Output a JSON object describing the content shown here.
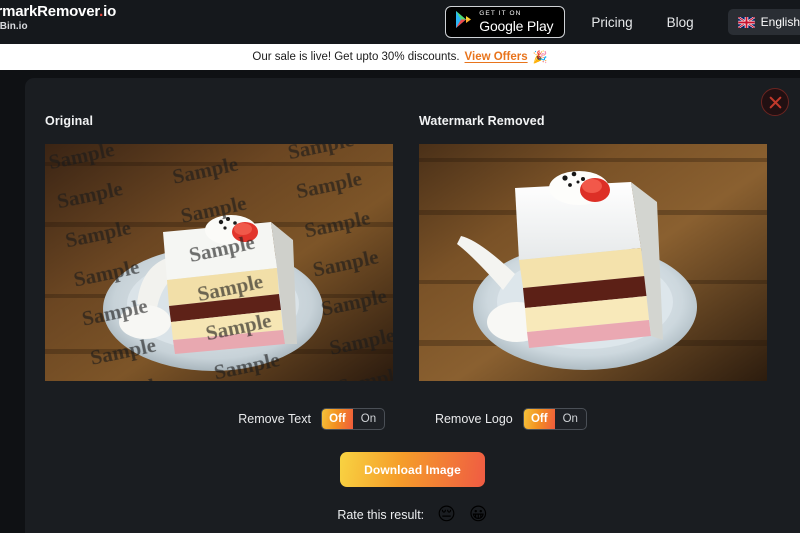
{
  "nav": {
    "brand_main": "WatermarkRemover.io",
    "brand_sub": "by PixelBin.io",
    "gplay_small": "GET IT ON",
    "gplay_big": "Google Play",
    "pricing": "Pricing",
    "blog": "Blog",
    "language": "English",
    "flag_icon": "uk-flag-icon",
    "gplay_icon": "google-play-icon"
  },
  "banner": {
    "text": "Our sale is live! Get upto 30% discounts.",
    "link": "View Offers",
    "emoji": "🎉",
    "link_color": "#e8741c",
    "background": "#ffffff"
  },
  "modal": {
    "close_icon": "close-icon",
    "panels": [
      {
        "title": "Original",
        "image": "watermarked-cake-image",
        "watermark_text": "Sample"
      },
      {
        "title": "Watermark Removed",
        "image": "clean-cake-image"
      }
    ],
    "controls": [
      {
        "label": "Remove Text",
        "options": [
          "Off",
          "On"
        ],
        "selected": "Off"
      },
      {
        "label": "Remove Logo",
        "options": [
          "Off",
          "On"
        ],
        "selected": "Off"
      }
    ],
    "download_label": "Download Image",
    "rate_label": "Rate this result:",
    "rate_options": [
      {
        "name": "rate-negative",
        "emoji": "😔"
      },
      {
        "name": "rate-positive",
        "emoji": "😀"
      }
    ],
    "accent_gradient_start": "#f8d342",
    "accent_gradient_end": "#ef5b43",
    "background": "#1a1d21"
  }
}
